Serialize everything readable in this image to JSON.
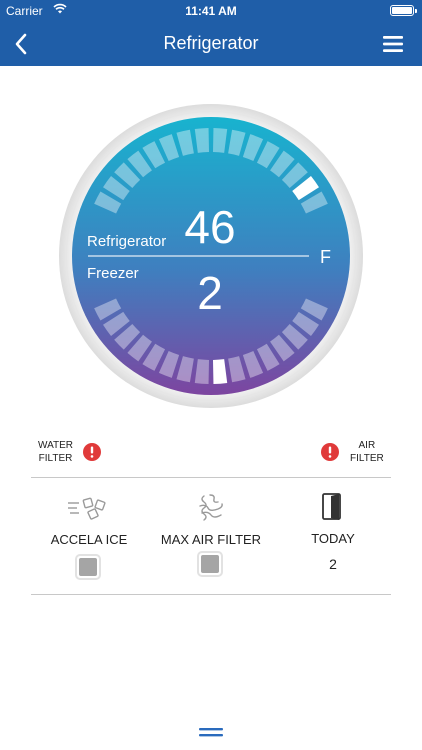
{
  "status_bar": {
    "carrier": "Carrier",
    "time": "11:41 AM"
  },
  "nav": {
    "title": "Refrigerator",
    "back_icon": "chevron-left-icon",
    "menu_icon": "hamburger-menu-icon"
  },
  "dial": {
    "refrigerator_label": "Refrigerator",
    "refrigerator_value": "46",
    "freezer_label": "Freezer",
    "freezer_value": "2",
    "unit": "F",
    "colors": {
      "top": "#1ab0d0",
      "bottom": "#7a48a0",
      "ring": "#e8e8e8"
    }
  },
  "filters": {
    "water_line1": "WATER",
    "water_line2": "FILTER",
    "air_line1": "AIR",
    "air_line2": "FILTER",
    "alert_color": "#e03a3a",
    "alert_icon": "exclamation-alert-icon"
  },
  "features": [
    {
      "label": "ACCELA ICE",
      "icon": "ice-cubes-icon",
      "checked": false
    },
    {
      "label": "MAX AIR FILTER",
      "icon": "air-filter-icon",
      "checked": false
    },
    {
      "label": "TODAY",
      "icon": "door-open-icon",
      "count": "2"
    }
  ]
}
